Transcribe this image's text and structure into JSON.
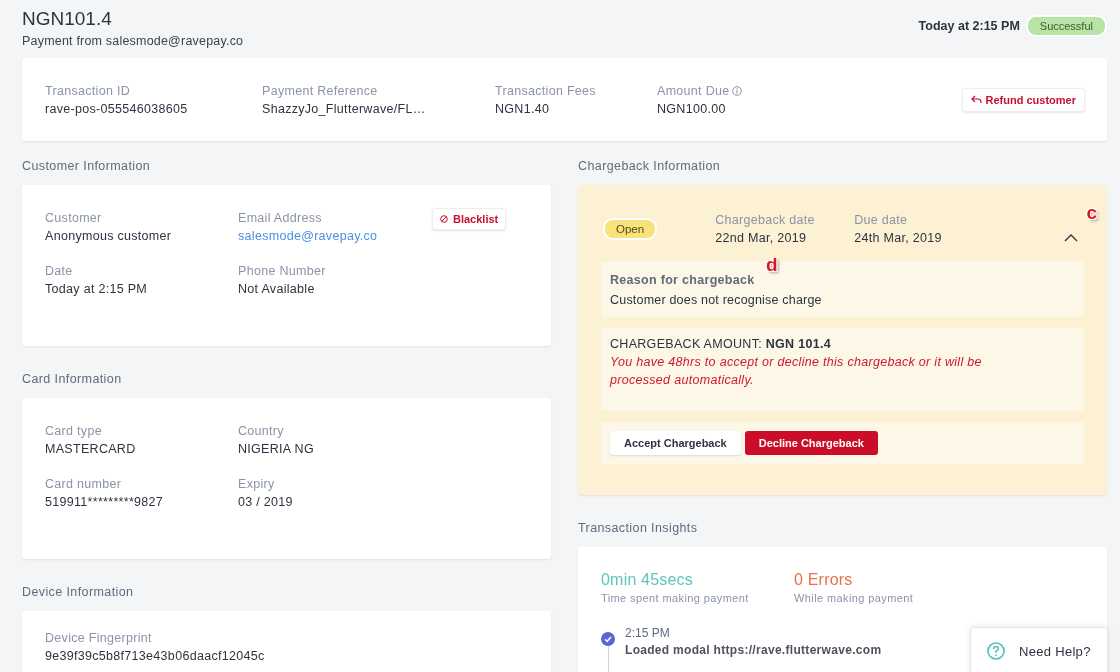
{
  "header": {
    "amount": "NGN101.4",
    "subtitle": "Payment from salesmode@ravepay.co",
    "time": "Today at 2:15 PM",
    "status": {
      "label": "Successful",
      "kind": "success"
    }
  },
  "summary": {
    "fields": [
      {
        "label": "Transaction ID",
        "value": "rave-pos-055546038605"
      },
      {
        "label": "Payment Reference",
        "value": "ShazzyJo_Flutterwave/FL…"
      },
      {
        "label": "Transaction Fees",
        "value": "NGN1.40"
      },
      {
        "label": "Amount Due",
        "value": "NGN100.00",
        "info": true
      }
    ],
    "refund_button": "Refund customer"
  },
  "sections": [
    {
      "title": "Customer Information",
      "action": "Blacklist",
      "fields": [
        {
          "label": "Customer",
          "value": "Anonymous customer",
          "kind": "text"
        },
        {
          "label": "Email Address",
          "value": "salesmode@ravepay.co",
          "kind": "link"
        },
        {
          "label": "Date",
          "value": "Today at 2:15 PM",
          "kind": "text"
        },
        {
          "label": "Phone Number",
          "value": "Not Available",
          "kind": "text"
        }
      ]
    },
    {
      "title": "Card Information",
      "fields": [
        {
          "label": "Card type",
          "value": "MASTERCARD",
          "kind": "text"
        },
        {
          "label": "Country",
          "value": "NIGERIA NG",
          "kind": "text"
        },
        {
          "label": "Card number",
          "value": "519911*********9827",
          "kind": "text"
        },
        {
          "label": "Expiry",
          "value": "03 / 2019",
          "kind": "text"
        }
      ]
    },
    {
      "title": "Device Information",
      "fields": [
        {
          "label": "Device Fingerprint",
          "value": "9e39f39c5b8f713e43b06daacf12045c",
          "kind": "text"
        }
      ]
    }
  ],
  "chargeback": {
    "title": "Chargeback Information",
    "status": "Open",
    "expanded": true,
    "dates": [
      {
        "label": "Chargeback date",
        "value": "22nd Mar, 2019"
      },
      {
        "label": "Due date",
        "value": "24th Mar, 2019"
      }
    ],
    "reason_label": "Reason for chargeback",
    "reason": "Customer does not recognise charge",
    "amount": "CHARGEBACK AMOUNT: **NGN 101.4**",
    "warning": "You have 48hrs to accept or decline this chargeback or it will be processed automatically.",
    "buttons": [
      {
        "label": "Accept Chargeback",
        "kind": "secondary"
      },
      {
        "label": "Decline Chargeback",
        "kind": "danger"
      }
    ],
    "markers": {
      "chevron": "c",
      "reason": "d"
    }
  },
  "insights": {
    "title": "Transaction Insights",
    "stats": [
      {
        "value": "0min 45secs",
        "caption": "Time spent making payment",
        "color": "#5ec4bd"
      },
      {
        "value": "0 Errors",
        "caption": "While making payment",
        "color": "#e8714b"
      }
    ],
    "timeline": [
      {
        "time": "2:15 PM",
        "event": "Loaded modal https://rave.flutterwave.com",
        "done": true
      }
    ]
  },
  "help": {
    "label": "Need Help?"
  }
}
